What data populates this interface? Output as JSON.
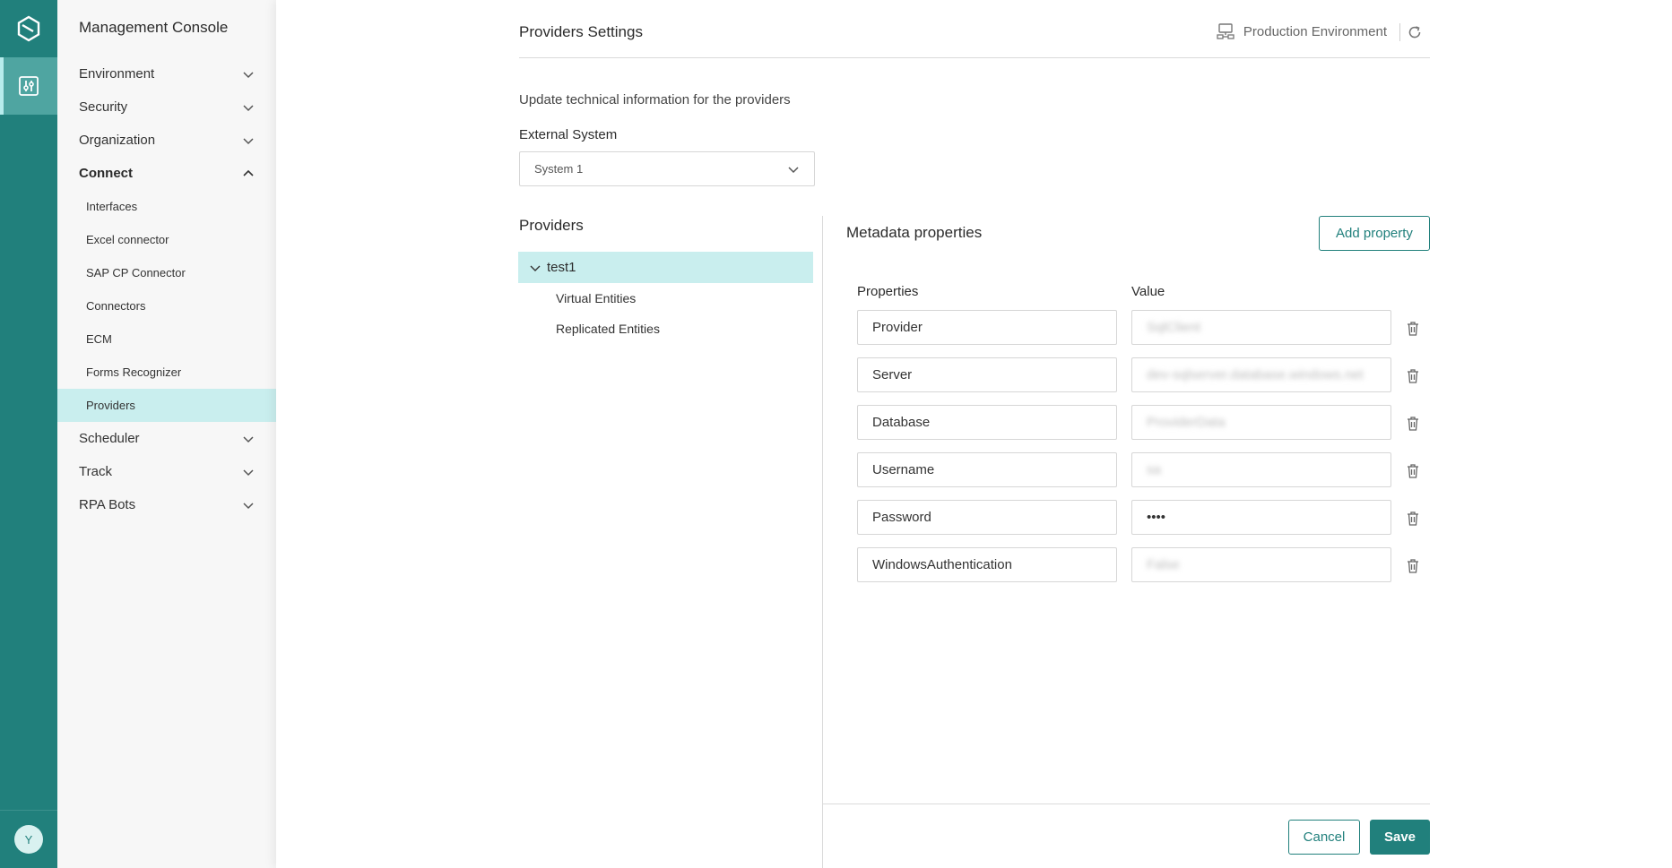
{
  "rail": {
    "logo_icon": "hexagon-logo-icon",
    "active_icon": "console-sliders-icon",
    "avatar_initial": "Y"
  },
  "sidebar": {
    "title": "Management Console",
    "items": [
      {
        "label": "Environment"
      },
      {
        "label": "Security"
      },
      {
        "label": "Organization"
      },
      {
        "label": "Connect",
        "open": true
      },
      {
        "label": "Scheduler"
      },
      {
        "label": "Track"
      },
      {
        "label": "RPA Bots"
      }
    ],
    "connect_children": [
      {
        "label": "Interfaces"
      },
      {
        "label": "Excel connector"
      },
      {
        "label": "SAP CP Connector"
      },
      {
        "label": "Connectors"
      },
      {
        "label": "ECM"
      },
      {
        "label": "Forms Recognizer"
      },
      {
        "label": "Providers",
        "active": true
      }
    ]
  },
  "header": {
    "title": "Providers Settings",
    "environment": "Production Environment"
  },
  "content": {
    "description": "Update technical information for the providers",
    "external_system_label": "External System",
    "external_system_value": "System 1",
    "providers_title": "Providers",
    "tree": {
      "root": "test1",
      "children": [
        "Virtual Entities",
        "Replicated Entities"
      ]
    },
    "metadata_title": "Metadata properties",
    "add_property_label": "Add property",
    "col_properties": "Properties",
    "col_value": "Value",
    "rows": [
      {
        "property": "Provider",
        "value": "SqlClient"
      },
      {
        "property": "Server",
        "value": "dev-sqlserver.database.windows.net"
      },
      {
        "property": "Database",
        "value": "ProviderData"
      },
      {
        "property": "Username",
        "value": "sa"
      },
      {
        "property": "Password",
        "value": "••••"
      },
      {
        "property": "WindowsAuthentication",
        "value": "False"
      }
    ]
  },
  "footer": {
    "cancel_label": "Cancel",
    "save_label": "Save"
  },
  "colors": {
    "primary": "#21807c",
    "selected_bg": "#c9eeee",
    "sidebar_bg": "#f7f7f7"
  }
}
